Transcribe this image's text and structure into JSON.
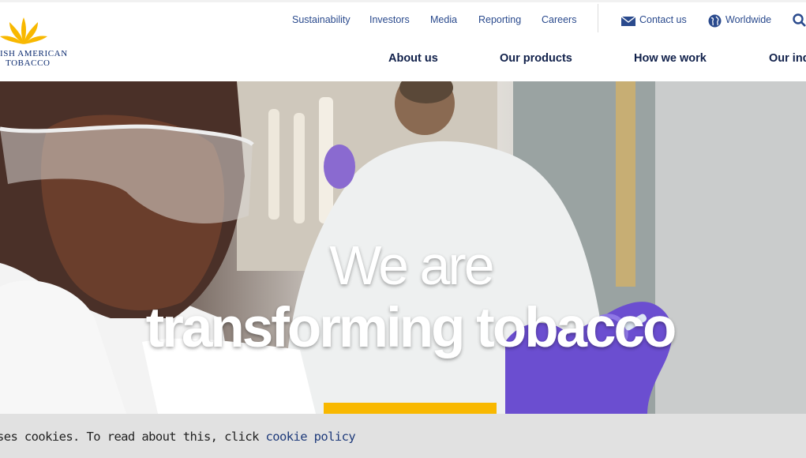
{
  "brand": {
    "logo_line1": "ISH AMERICAN",
    "logo_line2": "TOBACCO",
    "logo_color": "#f8b800"
  },
  "utility_nav": {
    "items": [
      "Sustainability",
      "Investors",
      "Media",
      "Reporting",
      "Careers"
    ],
    "contact_label": "Contact us",
    "worldwide_label": "Worldwide",
    "link_color": "#2a4a8d"
  },
  "main_nav": {
    "items": [
      "About us",
      "Our products",
      "How we work",
      "Our ind"
    ]
  },
  "hero": {
    "line1": "We are",
    "line2": "transforming tobacco",
    "cta_color": "#f8b800"
  },
  "cookie": {
    "text": "ses cookies. To read about this, click ",
    "link": "cookie policy"
  }
}
